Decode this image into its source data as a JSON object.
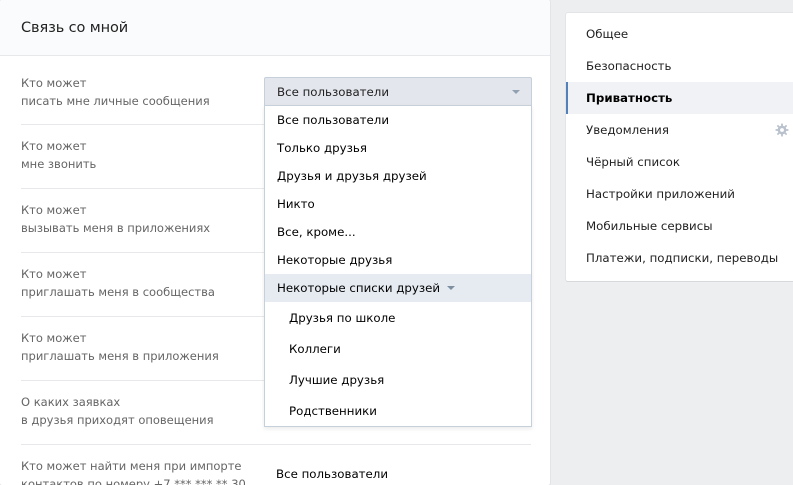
{
  "header": {
    "title": "Связь со мной"
  },
  "rows": [
    {
      "line1": "Кто может",
      "line2": "писать мне личные сообщения"
    },
    {
      "line1": "Кто может",
      "line2": "мне звонить"
    },
    {
      "line1": "Кто может",
      "line2": "вызывать меня в приложениях"
    },
    {
      "line1": "Кто может",
      "line2": "приглашать меня в сообщества"
    },
    {
      "line1": "Кто может",
      "line2": "приглашать меня в приложения"
    },
    {
      "line1": "О каких заявках",
      "line2": "в друзья приходят оповещения"
    },
    {
      "line1": "Кто может найти меня при импорте",
      "line2": "контактов по номеру +7 *** *** ** 30"
    }
  ],
  "select": {
    "value": "Все пользователи"
  },
  "dropdown": {
    "options": [
      "Все пользователи",
      "Только друзья",
      "Друзья и друзья друзей",
      "Никто",
      "Все, кроме...",
      "Некоторые друзья",
      "Некоторые списки друзей"
    ],
    "sublists": [
      "Друзья по школе",
      "Коллеги",
      "Лучшие друзья",
      "Родственники"
    ]
  },
  "last_row_value": "Все пользователи",
  "side_menu": {
    "items": [
      "Общее",
      "Безопасность",
      "Приватность",
      "Уведомления",
      "Чёрный список",
      "Настройки приложений",
      "Мобильные сервисы",
      "Платежи, подписки, переводы"
    ],
    "active_index": 2
  },
  "colors": {
    "accent": "#5181b8",
    "highlight": "#e5ebf1",
    "select_bg": "#e3e6ec"
  }
}
